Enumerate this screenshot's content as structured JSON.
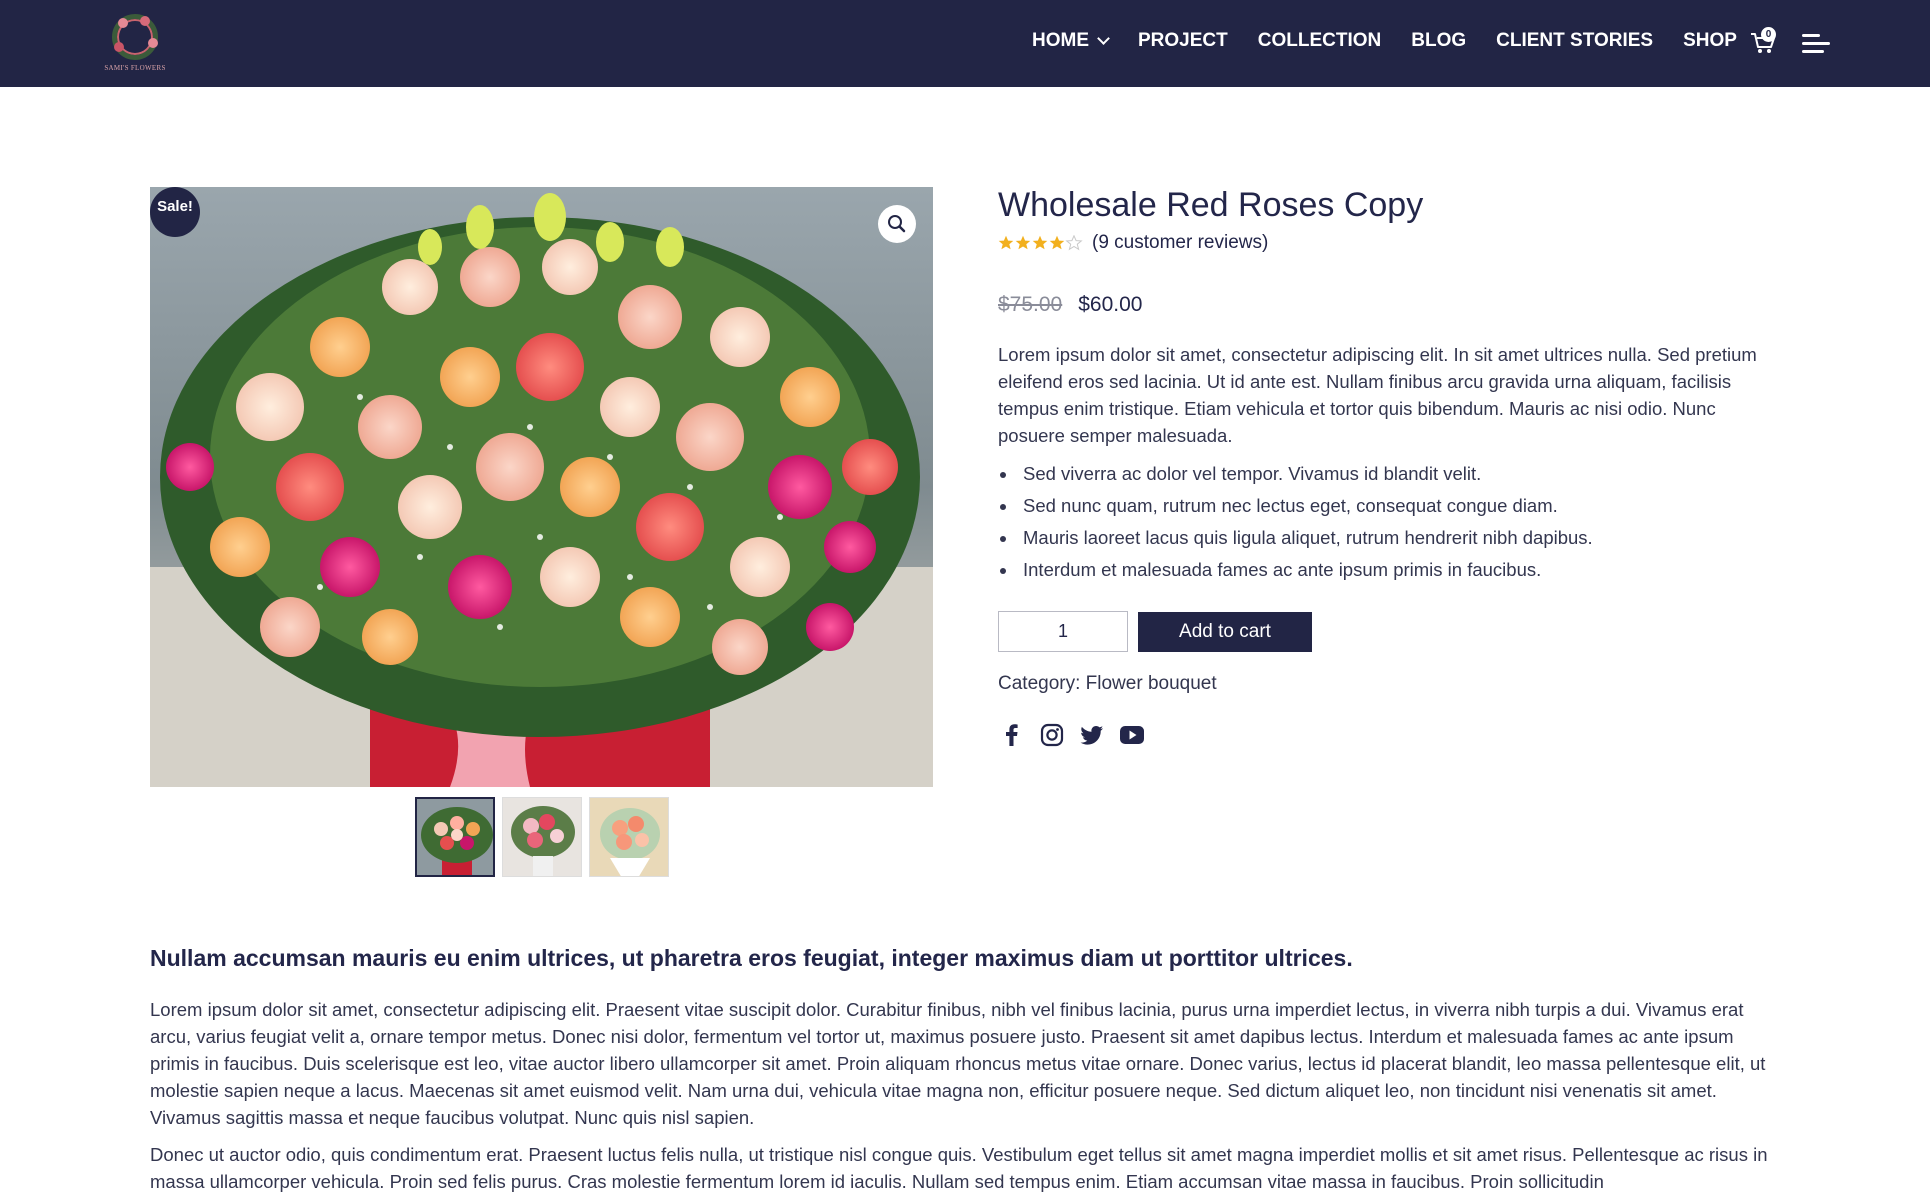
{
  "brand": {
    "logo_text": "SAMI'S FLOWERS"
  },
  "nav": {
    "items": [
      {
        "label": "HOME",
        "has_dropdown": true
      },
      {
        "label": "PROJECT"
      },
      {
        "label": "COLLECTION"
      },
      {
        "label": "BLOG"
      },
      {
        "label": "CLIENT STORIES"
      },
      {
        "label": "SHOP"
      }
    ],
    "cart_count": "0"
  },
  "product": {
    "sale_badge": "Sale!",
    "title": "Wholesale Red Roses Copy",
    "rating": 4,
    "rating_max": 5,
    "reviews_text": "(9 customer reviews)",
    "old_price": "$75.00",
    "price": "$60.00",
    "short_description": "Lorem ipsum dolor sit amet, consectetur adipiscing elit. In sit amet ultrices nulla. Sed pretium eleifend eros sed lacinia. Ut id ante est. Nullam finibus arcu gravida urna aliquam, facilisis tempus enim tristique. Etiam vehicula et tortor quis bibendum. Mauris ac nisi odio. Nunc posuere semper malesuada.",
    "bullets": [
      "Sed viverra ac dolor vel tempor. Vivamus id blandit velit.",
      "Sed nunc quam, rutrum nec lectus eget, consequat congue diam.",
      "Mauris laoreet lacus quis ligula aliquet, rutrum hendrerit nibh dapibus.",
      "Interdum et malesuada fames ac ante ipsum primis in faucibus."
    ],
    "quantity": "1",
    "add_to_cart_label": "Add to cart",
    "category_label": "Category:",
    "category_value": "Flower bouquet",
    "thumbnails": 3,
    "socials": [
      "facebook-icon",
      "instagram-icon",
      "twitter-icon",
      "youtube-icon"
    ]
  },
  "description": {
    "heading": "Nullam accumsan mauris eu enim ultrices, ut pharetra eros feugiat, integer maximus diam ut porttitor ultrices.",
    "paragraph1": "Lorem ipsum dolor sit amet, consectetur adipiscing elit. Praesent vitae suscipit dolor. Curabitur finibus, nibh vel finibus lacinia, purus urna imperdiet lectus, in viverra nibh turpis a dui. Vivamus erat arcu, varius feugiat velit a, ornare tempor metus. Donec nisi dolor, fermentum vel tortor ut, maximus posuere justo. Praesent sit amet dapibus lectus. Interdum et malesuada fames ac ante ipsum primis in faucibus. Duis scelerisque est leo, vitae auctor libero ullamcorper sit amet. Proin aliquam rhoncus metus vitae ornare. Donec varius, lectus id placerat blandit, leo massa pellentesque elit, ut molestie sapien neque a lacus. Maecenas sit amet euismod velit. Nam urna dui, vehicula vitae magna non, efficitur posuere neque. Sed dictum aliquet leo, non tincidunt nisi venenatis sit amet. Vivamus sagittis massa et neque faucibus volutpat. Nunc quis nisl sapien.",
    "paragraph2": "Donec ut auctor odio, quis condimentum erat. Praesent luctus felis nulla, ut tristique nisl congue quis. Vestibulum eget tellus sit amet magna imperdiet mollis et sit amet risus. Pellentesque ac risus in massa ullamcorper vehicula. Proin sed felis purus. Cras molestie fermentum lorem id iaculis. Nullam sed tempus enim. Etiam accumsan vitae massa in faucibus. Proin sollicitudin"
  },
  "colors": {
    "primary": "#222545",
    "text": "#33364f",
    "star": "#f2b01e",
    "white": "#ffffff"
  }
}
